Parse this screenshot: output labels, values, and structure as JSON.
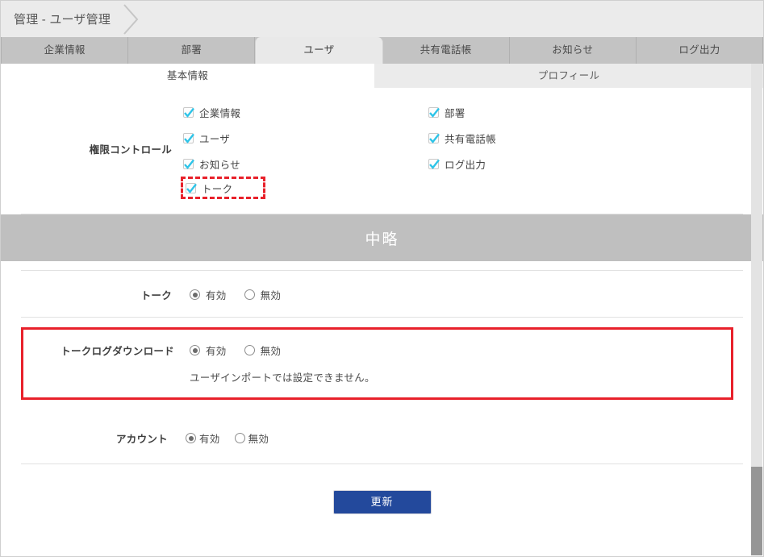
{
  "breadcrumb": {
    "text": "管理 - ユーザ管理",
    "chevron_icon": "chevron-right-icon"
  },
  "tabs": [
    {
      "label": "企業情報",
      "active": false
    },
    {
      "label": "部署",
      "active": false
    },
    {
      "label": "ユーザ",
      "active": true
    },
    {
      "label": "共有電話帳",
      "active": false
    },
    {
      "label": "お知らせ",
      "active": false
    },
    {
      "label": "ログ出力",
      "active": false
    }
  ],
  "subtabs": [
    {
      "label": "基本情報",
      "active": true
    },
    {
      "label": "プロフィール",
      "active": false
    }
  ],
  "permission_section": {
    "label": "権限コントロール",
    "left_column": [
      {
        "label": "企業情報",
        "checked": true,
        "highlighted": false
      },
      {
        "label": "ユーザ",
        "checked": true,
        "highlighted": false
      },
      {
        "label": "お知らせ",
        "checked": true,
        "highlighted": false
      },
      {
        "label": "トーク",
        "checked": true,
        "highlighted": true
      }
    ],
    "right_column": [
      {
        "label": "部署",
        "checked": true
      },
      {
        "label": "共有電話帳",
        "checked": true
      },
      {
        "label": "ログ出力",
        "checked": true
      }
    ]
  },
  "omitted_band": {
    "text": "中略"
  },
  "talk_row": {
    "label": "トーク",
    "options": [
      {
        "label": "有効",
        "selected": true
      },
      {
        "label": "無効",
        "selected": false
      }
    ]
  },
  "talk_log_row": {
    "label": "トークログダウンロード",
    "options": [
      {
        "label": "有効",
        "selected": true
      },
      {
        "label": "無効",
        "selected": false
      }
    ],
    "note": "ユーザインポートでは設定できません。",
    "highlighted": true
  },
  "account_row": {
    "label": "アカウント",
    "options": [
      {
        "label": "有効",
        "selected": true
      },
      {
        "label": "無効",
        "selected": false
      }
    ]
  },
  "footer": {
    "update_label": "更新"
  },
  "colors": {
    "accent_blue": "#23499c",
    "highlight_red": "#e8212b",
    "check_cyan": "#2ec4e8",
    "band_gray": "#bfbfbf",
    "tabbar_gray": "#c3c3c3",
    "active_tab_gray": "#e9e9e9"
  }
}
